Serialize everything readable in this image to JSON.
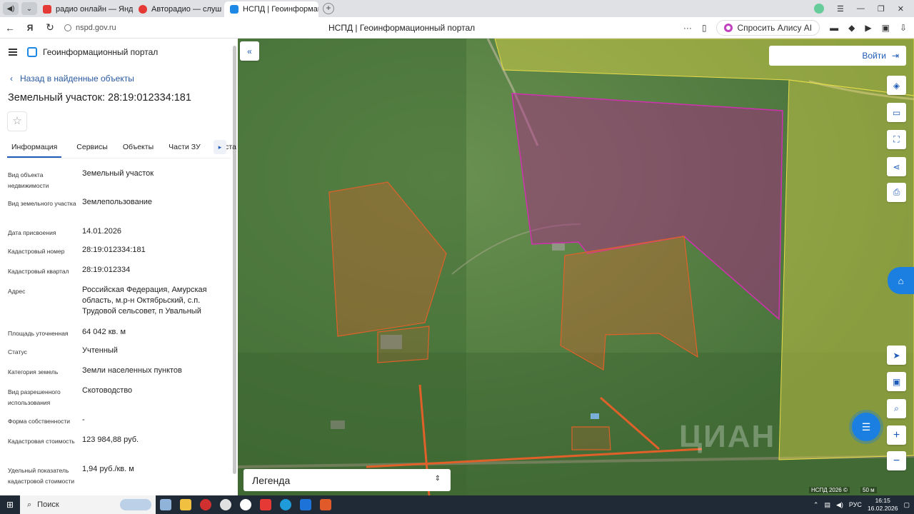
{
  "browser": {
    "tabs": [
      {
        "label": "радио онлайн — Яндекс:",
        "color": "#e53935",
        "active": false
      },
      {
        "label": "Авторадио — слуш",
        "color": "#e53935",
        "active": false
      },
      {
        "label": "НСПД | Геоинформац",
        "color": "#1e88e5",
        "active": true
      }
    ],
    "url": "nspd.gov.ru",
    "page_title": "НСПД | Геоинформационный портал",
    "alice_label": "Спросить Алису AI"
  },
  "panel": {
    "portal_name": "Геоинформационный портал",
    "back_link": "Назад в найденные объекты",
    "object_title": "Земельный участок: 28:19:012334:181",
    "tabs": [
      "Информация",
      "Сервисы",
      "Объекты",
      "Части ЗУ",
      "Соста"
    ],
    "active_tab": "Информация",
    "rows": [
      {
        "k": "Вид объекта недвижимости",
        "v": "Земельный участок"
      },
      {
        "k": "Вид земельного участка",
        "v": "Землепользование"
      },
      {
        "k": "Дата присвоения",
        "v": "14.01.2026"
      },
      {
        "k": "Кадастровый номер",
        "v": "28:19:012334:181"
      },
      {
        "k": "Кадастровый квартал",
        "v": "28:19:012334"
      },
      {
        "k": "Адрес",
        "v": "Российская Федерация, Амурская область, м.р-н Октябрьский, с.п. Трудовой сельсовет, п Увальный"
      },
      {
        "k": "Площадь уточненная",
        "v": "64 042 кв. м"
      },
      {
        "k": "Статус",
        "v": "Учтенный"
      },
      {
        "k": "Категория земель",
        "v": "Земли населенных пунктов"
      },
      {
        "k": "Вид разрешенного использования",
        "v": "Скотоводство"
      },
      {
        "k": "Форма собственности",
        "v": "-"
      },
      {
        "k": "Кадастровая стоимость",
        "v": "123 984,88 руб."
      },
      {
        "k": "Удельный показатель кадастровой стоимости",
        "v": "1,94 руб./кв. м"
      }
    ]
  },
  "map": {
    "login_label": "Войти",
    "legend_label": "Легенда",
    "watermark": "ЦИАН",
    "attribution": "НСПД 2026 ©",
    "scale_label": "50 м",
    "colors": {
      "parcel_selected": "#b0208c",
      "parcel_other": "#e0602a",
      "zone_yellow": "#e6dc4a"
    }
  },
  "taskbar": {
    "search_label": "Поиск",
    "lang": "РУС",
    "time": "16:15",
    "date": "16.02.2026"
  }
}
